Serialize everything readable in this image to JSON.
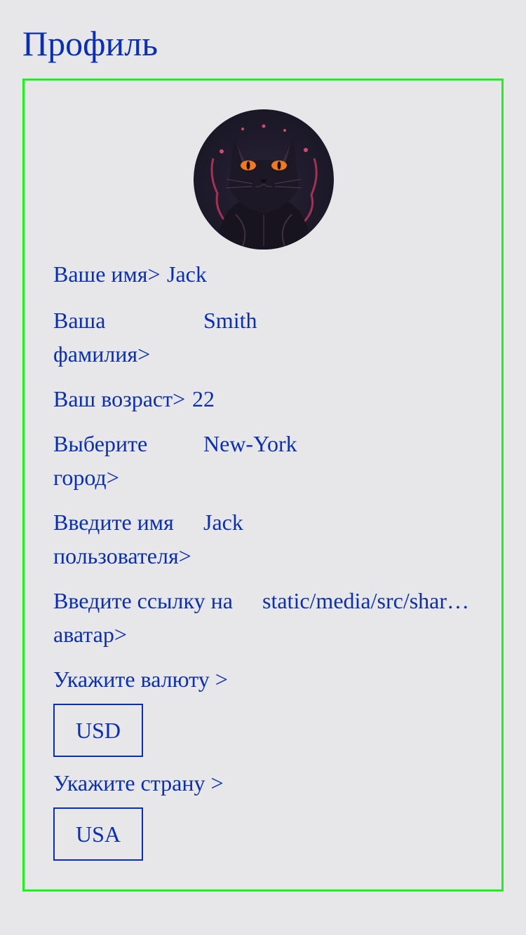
{
  "page": {
    "title": "Профиль"
  },
  "profile": {
    "avatar_icon": "black-cat-avatar",
    "fields": {
      "name": {
        "label": "Ваше имя>",
        "value": "Jack"
      },
      "surname": {
        "label_line1": "Ваша",
        "label_line2": "фамилия>",
        "value": "Smith"
      },
      "age": {
        "label": "Ваш возраст>",
        "value": "22"
      },
      "city": {
        "label_line1": "Выберите",
        "label_line2": "город>",
        "value": "New-York"
      },
      "username": {
        "label_line1": "Введите имя",
        "label_line2": "пользователя>",
        "value": "Jack"
      },
      "avatar_link": {
        "label_line1": "Введите ссылку на",
        "label_line2": "аватар>",
        "value": "static/media/src/shar…"
      }
    },
    "currency": {
      "label": "Укажите валюту >",
      "value": "USD"
    },
    "country": {
      "label": "Укажите страну >",
      "value": "USA"
    }
  },
  "colors": {
    "text": "#0a2fb0",
    "background": "#e7e7ea",
    "card_border": "#1ef21e"
  }
}
